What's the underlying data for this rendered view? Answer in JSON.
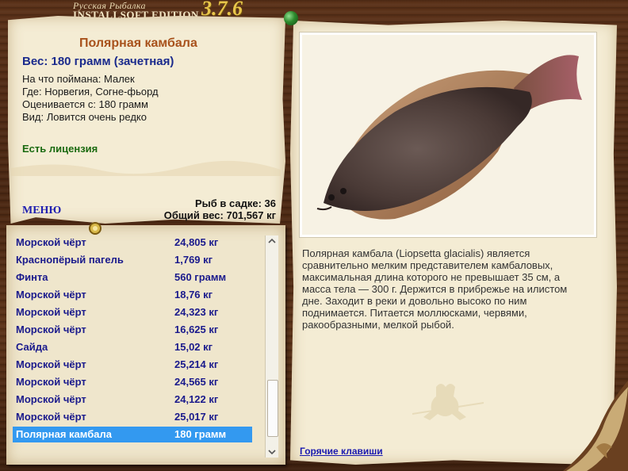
{
  "app": {
    "title_small": "Русская Рыбалка",
    "edition": "INSTALLSOFT EDITION",
    "version": "3.7.6"
  },
  "catch": {
    "name": "Полярная камбала",
    "weight": "Вес: 180 грамм (зачетная)",
    "bait": "На что поймана: Малек",
    "place": "Где: Норвегия, Согне-фьорд",
    "valued": "Оценивается с: 180 грамм",
    "kind": "Вид: Ловится очень редко",
    "license": "Есть лицензия"
  },
  "menu_label": "МЕНЮ",
  "stats": {
    "count": "Рыб в садке: 36",
    "total": "Общий вес: 701,567 кг"
  },
  "list": {
    "rows": [
      {
        "name": "Морской чёрт",
        "weight": "24,805 кг"
      },
      {
        "name": "Краснопёрый пагель",
        "weight": "1,769 кг"
      },
      {
        "name": "Финта",
        "weight": "560 грамм"
      },
      {
        "name": "Морской чёрт",
        "weight": "18,76 кг"
      },
      {
        "name": "Морской чёрт",
        "weight": "24,323 кг"
      },
      {
        "name": "Морской чёрт",
        "weight": "16,625 кг"
      },
      {
        "name": "Сайда",
        "weight": "15,02 кг"
      },
      {
        "name": "Морской чёрт",
        "weight": "25,214 кг"
      },
      {
        "name": "Морской чёрт",
        "weight": "24,565 кг"
      },
      {
        "name": "Морской чёрт",
        "weight": "24,122 кг"
      },
      {
        "name": "Морской чёрт",
        "weight": "25,017 кг"
      },
      {
        "name": "Полярная камбала",
        "weight": "180 грамм"
      }
    ],
    "selected_index": 11
  },
  "description": "Полярная камбала (Liopsetta glacialis) является сравнительно мелким представителем камбаловых, максимальная длина которого не превышает 35 см, а масса тела — 300 г. Держится в прибрежье на илистом дне. Заходит в реки и довольно высоко по ним поднимается. Питается моллюсками, червями, ракообразными, мелкой рыбой.",
  "hotkeys_label": "Горячие клавиши",
  "icons": {
    "pin": "green-pin-icon",
    "ring": "fishing-ring-icon",
    "scroll_up": "scroll-up-arrow-icon",
    "scroll_down": "scroll-down-arrow-icon",
    "watermark": "fisherman-silhouette-icon"
  },
  "colors": {
    "fish_name": "#a8521c",
    "weight": "#1a2a8c",
    "license": "#1a6a10",
    "list_text": "#1a1a8c",
    "selection": "#3399f0",
    "paper": "#f4ecd4"
  }
}
